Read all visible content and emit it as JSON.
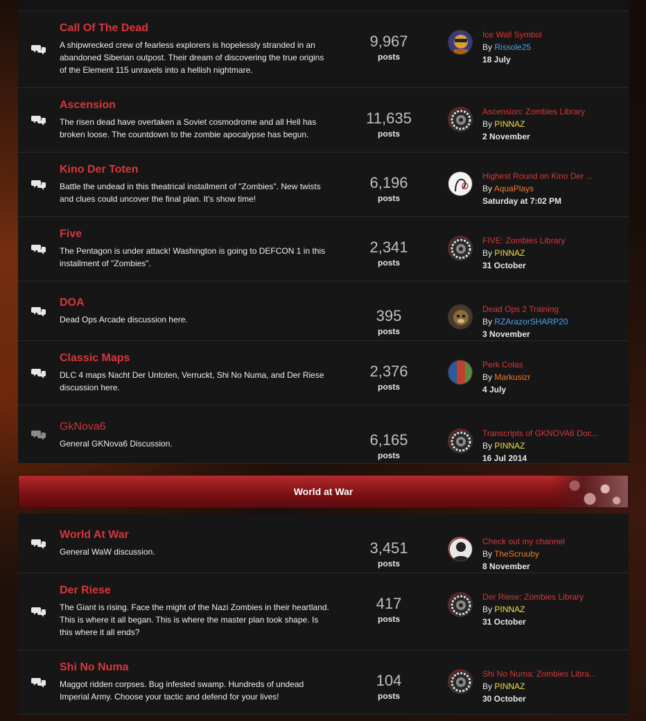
{
  "forums_group1": [
    {
      "title": "Call Of The Dead",
      "desc": "A shipwrecked crew of fearless explorers is hopelessly stranded in an abandoned Siberian outpost. Their dream of discovering the true origins of the Element 115 unravels into a hellish nightmare.",
      "posts": "9,967",
      "posts_label": "posts",
      "last_title": "Ice Wall Symbol",
      "by": "By",
      "last_user": "Rissole25",
      "user_color": "#4aa3f0",
      "last_date": "18 July",
      "avatar": "avatar-portrait"
    },
    {
      "title": "Ascension",
      "desc": "The risen dead have overtaken a Soviet cosmodrome and all Hell has broken loose. The countdown to the zombie apocalypse has begun.",
      "posts": "11,635",
      "posts_label": "posts",
      "last_title": "Ascension: Zombies Library",
      "by": "By",
      "last_user": "PINNAZ",
      "user_color": "#f0e040",
      "last_date": "2 November",
      "avatar": "avatar-gear"
    },
    {
      "title": "Kino Der Toten",
      "desc": "Battle the undead in this theatrical installment of \"Zombies\". New twists and clues could uncover the final plan. It's show time!",
      "posts": "6,196",
      "posts_label": "posts",
      "last_title": "Highest Round on Kino Der ...",
      "by": "By",
      "last_user": "AquaPlays",
      "user_color": "#f07a2a",
      "last_date": "Saturday at 7:02 PM",
      "avatar": "avatar-sketch"
    },
    {
      "title": "Five",
      "desc": "The Pentagon is under attack! Washington is going to DEFCON 1 in this installment of \"Zombies\".",
      "posts": "2,341",
      "posts_label": "posts",
      "last_title": "FIVE: Zombies Library",
      "by": "By",
      "last_user": "PINNAZ",
      "user_color": "#f0e040",
      "last_date": "31 October",
      "avatar": "avatar-gear"
    },
    {
      "title": "DOA",
      "desc": "Dead Ops Arcade discussion here.",
      "posts": "395",
      "posts_label": "posts",
      "last_title": "Dead Ops 2 Training",
      "by": "By",
      "last_user": "RZArazorSHARP20",
      "user_color": "#4aa3f0",
      "last_date": "3 November",
      "avatar": "avatar-monkey"
    },
    {
      "title": "Classic Maps",
      "desc": "DLC 4 maps Nacht Der Untoten, Verruckt, Shi No Numa, and Der Riese discussion here.",
      "posts": "2,376",
      "posts_label": "posts",
      "last_title": "Perk Colas",
      "by": "By",
      "last_user": "Markusizr",
      "user_color": "#f07a2a",
      "last_date": "4 July",
      "avatar": "avatar-colas"
    },
    {
      "title": "GkNova6",
      "desc": "General GKNova6 Discussion.",
      "posts": "6,165",
      "posts_label": "posts",
      "last_title": "Transcripts of GKNOVA6 Doc...",
      "by": "By",
      "last_user": "PINNAZ",
      "user_color": "#f0e040",
      "last_date": "16 Jul 2014",
      "avatar": "avatar-gear",
      "read": true
    }
  ],
  "category": {
    "title": "World at War"
  },
  "forums_group2": [
    {
      "title": "World At War",
      "desc": "General WaW discussion.",
      "posts": "3,451",
      "posts_label": "posts",
      "last_title": "Check out my channel",
      "by": "By",
      "last_user": "TheScruuby",
      "user_color": "#f07a2a",
      "last_date": "8 November",
      "avatar": "avatar-default"
    },
    {
      "title": "Der Riese",
      "desc": "The Giant is rising. Face the might of the Nazi Zombies in their heartland. This is where it all began. This is where the master plan took shape. Is this where it all ends?",
      "posts": "417",
      "posts_label": "posts",
      "last_title": "Der Riese: Zombies Library",
      "by": "By",
      "last_user": "PINNAZ",
      "user_color": "#f0e040",
      "last_date": "31 October",
      "avatar": "avatar-gear"
    },
    {
      "title": "Shi No Numa",
      "desc": "Maggot ridden corpses. Bug infested swamp. Hundreds of undead Imperial Army. Choose your tactic and defend for your lives!",
      "posts": "104",
      "posts_label": "posts",
      "last_title": "Shi No Numa: Zombies Libra...",
      "by": "By",
      "last_user": "PINNAZ",
      "user_color": "#f0e040",
      "last_date": "30 October",
      "avatar": "avatar-gear"
    }
  ]
}
